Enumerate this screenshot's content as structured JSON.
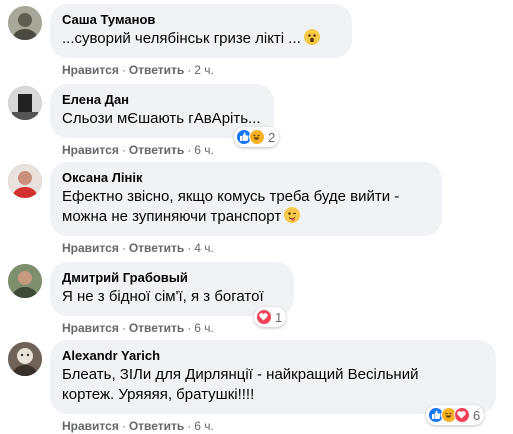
{
  "actions": {
    "like": "Нравится",
    "reply": "Ответить"
  },
  "comments": [
    {
      "author": "Саша Туманов",
      "text": "...суворий челябінськ гризе лікті ...",
      "time": "2 ч.",
      "emoji": "astonished-face-icon"
    },
    {
      "author": "Елена Дан",
      "text": "Сльози мЄшають гАвАріть...",
      "time": "6 ч.",
      "reactions": {
        "icons": [
          "like-reaction-icon",
          "haha-reaction-icon"
        ],
        "count": "2"
      }
    },
    {
      "author": "Оксана Лінік",
      "text_line1": "Ефектно звісно, якщо комусь треба буде вийти -",
      "text_line2": "можна не зупиняючи транспорт",
      "time": "4 ч.",
      "emoji": "wink-tongue-face-icon"
    },
    {
      "author": "Дмитрий Грабовый",
      "text": "Я не з бідної сім'ї, я з богатої",
      "time": "6 ч.",
      "reactions": {
        "icons": [
          "love-reaction-icon"
        ],
        "count": "1"
      }
    },
    {
      "author": "Alexandr Yarich",
      "text_line1": "Блеать, ЗІЛи для Дирлянції - найкращий Весільний",
      "text_line2": "кортеж. Уряяяя, братушкі!!!!",
      "time": "6 ч.",
      "reactions": {
        "icons": [
          "like-reaction-icon",
          "haha-reaction-icon",
          "love-reaction-icon"
        ],
        "count": "6"
      }
    }
  ],
  "colors": {
    "bubble": "#f0f2f5",
    "meta": "#65676b",
    "like": "#1877f2",
    "haha": "#f7b125",
    "love": "#f33e58"
  }
}
